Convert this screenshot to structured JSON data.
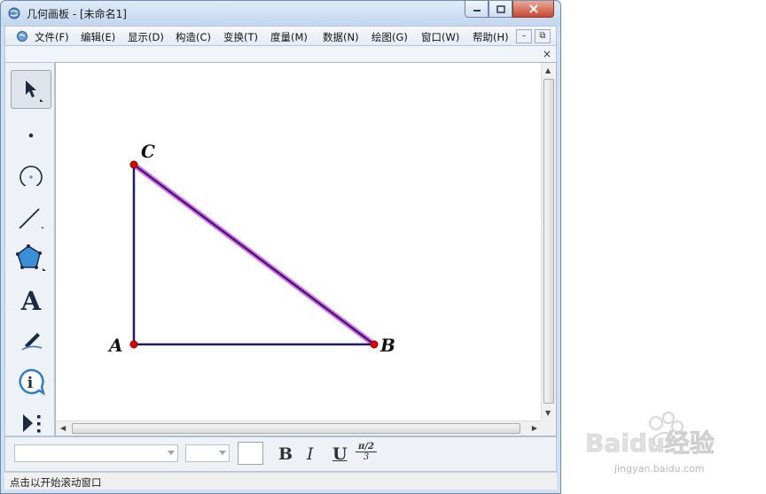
{
  "window": {
    "title": "几何画板 - [未命名1]"
  },
  "menubar": {
    "items": [
      "文件(F)",
      "编辑(E)",
      "显示(D)",
      "构造(C)",
      "变换(T)",
      "度量(M)",
      "数据(N)",
      "绘图(G)",
      "窗口(W)",
      "帮助(H)"
    ],
    "mdi_minimize": "–",
    "mdi_restore": "⧉",
    "doc_close": "×"
  },
  "toolbox": {
    "tools": [
      "arrow-select-tool",
      "point-tool",
      "compass-tool",
      "straightedge-tool",
      "polygon-tool",
      "text-tool",
      "marker-tool",
      "information-tool",
      "custom-tool"
    ]
  },
  "sketch": {
    "points": [
      {
        "label": "A"
      },
      {
        "label": "B"
      },
      {
        "label": "C"
      }
    ],
    "segments": [
      "AB",
      "AC",
      "CB"
    ],
    "selected_segment": "CB",
    "colors": {
      "segment": "#1a1a6e",
      "point": "#e00000",
      "selection": "#e060e0"
    }
  },
  "textbar": {
    "font_value": "",
    "size_value": "",
    "bold_label": "B",
    "italic_label": "I",
    "underline_label": "U",
    "math_label_top": "π/2",
    "math_label_bottom": "3"
  },
  "status": {
    "text": "点击以开始滚动窗口"
  },
  "watermark": {
    "brand": "Baidu经验",
    "url": "jingyan.baidu.com"
  }
}
